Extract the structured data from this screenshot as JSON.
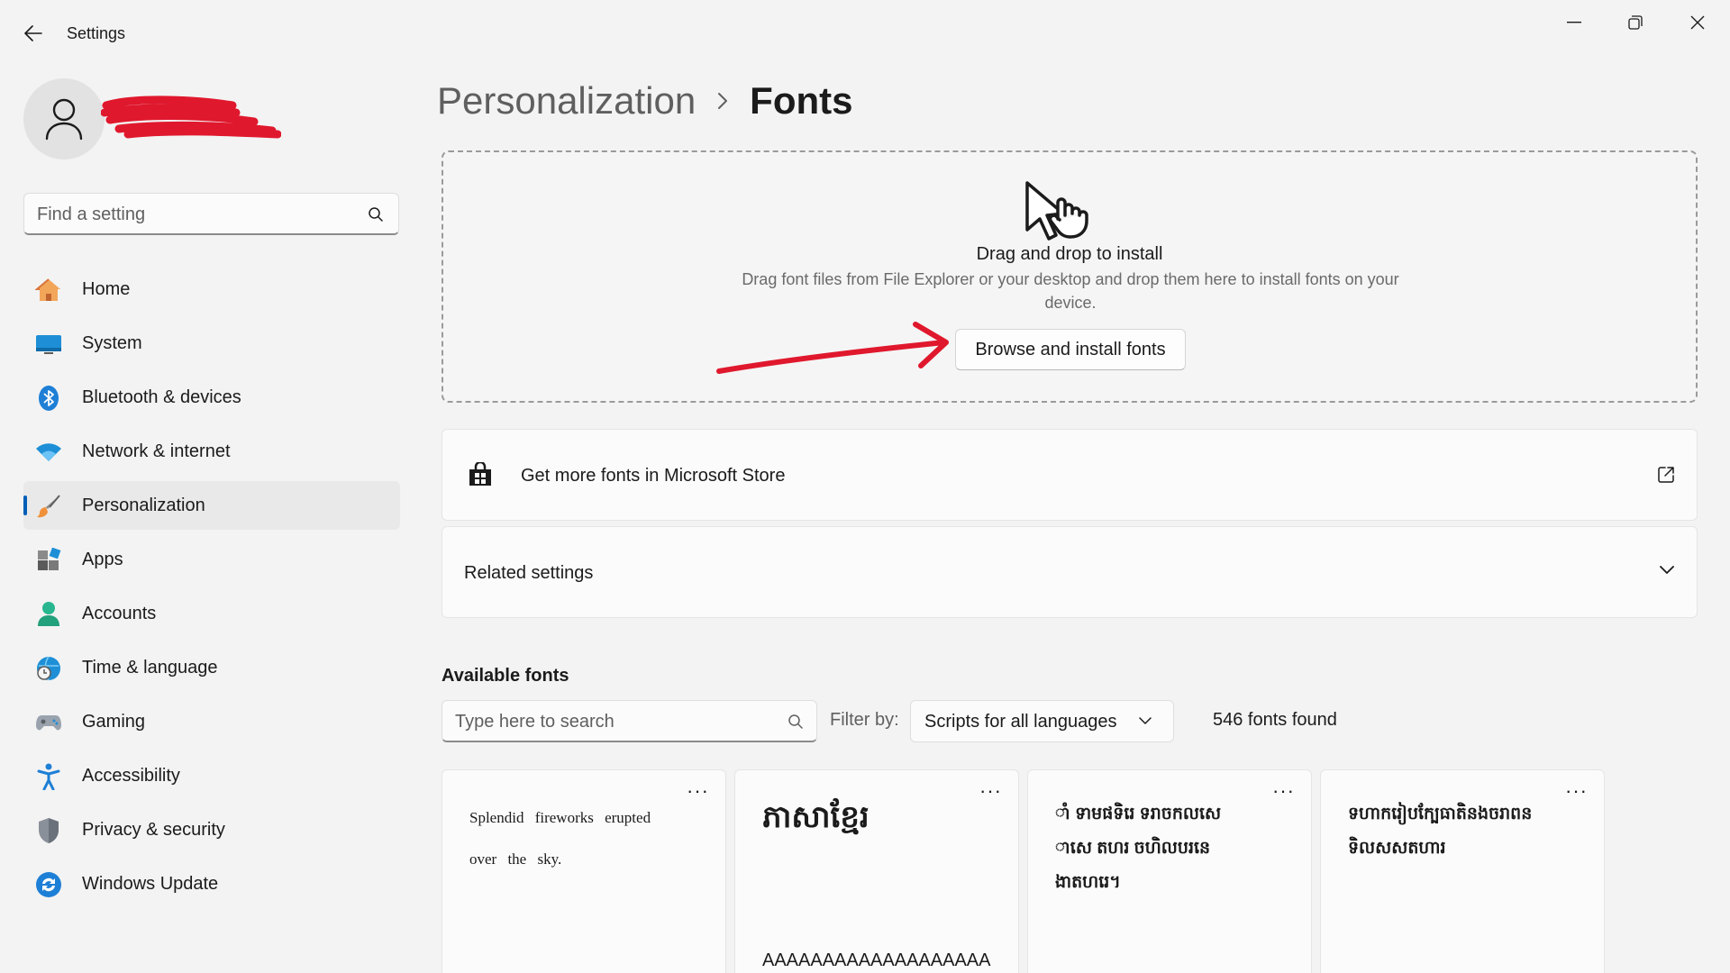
{
  "window": {
    "title": "Settings"
  },
  "sidebar": {
    "search_placeholder": "Find a setting",
    "items": [
      {
        "label": "Home",
        "icon": "home-icon"
      },
      {
        "label": "System",
        "icon": "system-icon"
      },
      {
        "label": "Bluetooth & devices",
        "icon": "bluetooth-icon"
      },
      {
        "label": "Network & internet",
        "icon": "wifi-icon"
      },
      {
        "label": "Personalization",
        "icon": "brush-icon",
        "active": true
      },
      {
        "label": "Apps",
        "icon": "apps-icon"
      },
      {
        "label": "Accounts",
        "icon": "accounts-icon"
      },
      {
        "label": "Time & language",
        "icon": "globe-clock-icon"
      },
      {
        "label": "Gaming",
        "icon": "gamepad-icon"
      },
      {
        "label": "Accessibility",
        "icon": "accessibility-icon"
      },
      {
        "label": "Privacy & security",
        "icon": "shield-icon"
      },
      {
        "label": "Windows Update",
        "icon": "update-icon"
      }
    ]
  },
  "breadcrumb": {
    "parent": "Personalization",
    "current": "Fonts"
  },
  "drop_zone": {
    "title": "Drag and drop to install",
    "description": "Drag font files from File Explorer or your desktop and drop them here to install fonts on your device.",
    "browse_label": "Browse and install fonts"
  },
  "store_card": {
    "label": "Get more fonts in Microsoft Store"
  },
  "related_card": {
    "label": "Related settings"
  },
  "available": {
    "title": "Available fonts",
    "search_placeholder": "Type here to search",
    "filter_label": "Filter by:",
    "filter_value": "Scripts for all languages",
    "count": "546 fonts found"
  },
  "font_cards": [
    {
      "sample": "Splendid fireworks erupted over the sky.",
      "more": "···"
    },
    {
      "sample": "ភាសាខ្មែរ",
      "sample2": "AAAAAAAAAAAAAAAAAAA",
      "more": "···"
    },
    {
      "sample": "ាំ ទាមផទិរេ ទរាចកលសេ ាសេ តហរ ចហិលបរនេ ងាតហរេ។",
      "more": "···"
    },
    {
      "sample": "ទហាករៀបក្បែធាតិនងចរាពន ទិលសសតហារ",
      "more": "···"
    }
  ],
  "colors": {
    "accent": "#005fb8",
    "background": "#f3f3f3",
    "annotation": "#e0182d"
  }
}
